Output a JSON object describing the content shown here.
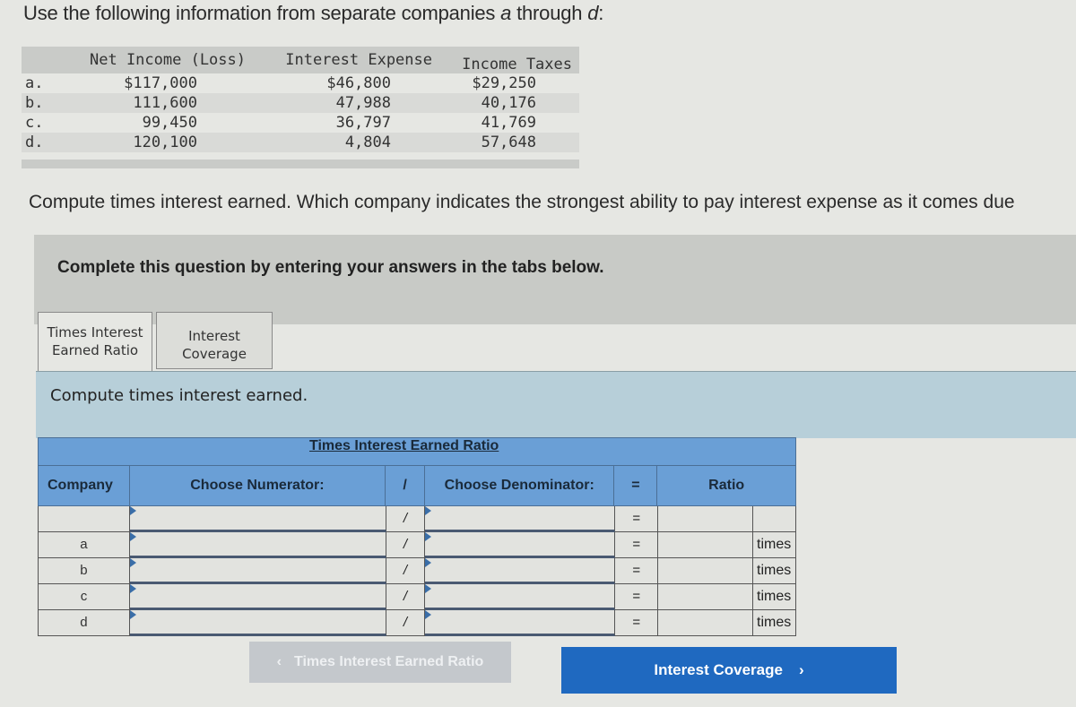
{
  "intro": {
    "text": "Use the following information from separate companies ",
    "italic_a": "a",
    "mid": " through ",
    "italic_d": "d",
    "end": ":"
  },
  "data_table": {
    "headers": {
      "net_income": "Net Income (Loss)",
      "interest_expense": "Interest Expense",
      "income_taxes": "Income Taxes"
    },
    "rows": [
      {
        "letter": "a.",
        "net_income": "$117,000",
        "interest_expense": "$46,800",
        "income_taxes": "$29,250"
      },
      {
        "letter": "b.",
        "net_income": "111,600",
        "interest_expense": "47,988",
        "income_taxes": "40,176"
      },
      {
        "letter": "c.",
        "net_income": "99,450",
        "interest_expense": "36,797",
        "income_taxes": "41,769"
      },
      {
        "letter": "d.",
        "net_income": "120,100",
        "interest_expense": "4,804",
        "income_taxes": "57,648"
      }
    ]
  },
  "question": "Compute times interest earned. Which company indicates the strongest ability to pay interest expense as it comes due",
  "instruction": "Complete this question by entering your answers in the tabs below.",
  "tabs": [
    {
      "label_line1": "Times Interest",
      "label_line2": "Earned Ratio",
      "active": true
    },
    {
      "label_line1": "Interest",
      "label_line2": "Coverage",
      "active": false
    }
  ],
  "subheader": "Compute times interest earned.",
  "grid": {
    "title": "Times Interest Earned Ratio",
    "headers": {
      "company": "Company",
      "numerator": "Choose Numerator:",
      "slash": "/",
      "denominator": "Choose Denominator:",
      "equals": "=",
      "ratio": "Ratio"
    },
    "rows": [
      {
        "company": "",
        "numerator": "",
        "slash": "/",
        "denominator": "",
        "equals": "=",
        "value": "",
        "unit": ""
      },
      {
        "company": "a",
        "numerator": "",
        "slash": "/",
        "denominator": "",
        "equals": "=",
        "value": "",
        "unit": "times"
      },
      {
        "company": "b",
        "numerator": "",
        "slash": "/",
        "denominator": "",
        "equals": "=",
        "value": "",
        "unit": "times"
      },
      {
        "company": "c",
        "numerator": "",
        "slash": "/",
        "denominator": "",
        "equals": "=",
        "value": "",
        "unit": "times"
      },
      {
        "company": "d",
        "numerator": "",
        "slash": "/",
        "denominator": "",
        "equals": "=",
        "value": "",
        "unit": "times"
      }
    ]
  },
  "nav": {
    "prev_label": "Times Interest Earned Ratio",
    "prev_icon": "‹",
    "next_label": "Interest Coverage",
    "next_icon": "›"
  }
}
